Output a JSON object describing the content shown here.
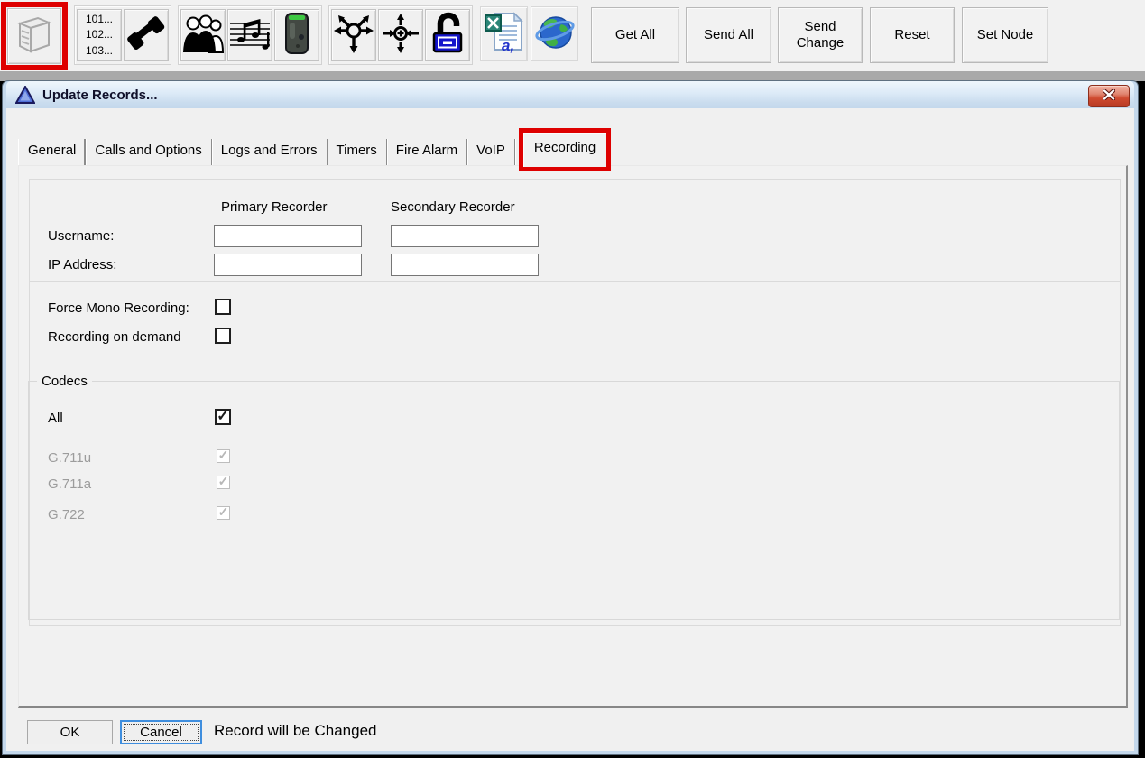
{
  "annotation": {
    "color": "#de0000",
    "targets": [
      "server-toolbar-button",
      "recording-tab"
    ]
  },
  "toolbar": {
    "icons": [
      "server-icon",
      "extension-list-icon",
      "phone-icon",
      "contacts-icon",
      "music-icon",
      "recorder-icon",
      "broadcast-arrows-icon",
      "multicast-target-icon",
      "lock-icon",
      "excel-export-icon",
      "globe-icon"
    ],
    "extension_list_lines": [
      "101...",
      "102...",
      "103..."
    ],
    "buttons": {
      "get_all": "Get All",
      "send_all": "Send All",
      "send_change": "Send Change",
      "reset": "Reset",
      "set_node": "Set Node"
    }
  },
  "dialog": {
    "title": "Update Records...",
    "tabs": [
      {
        "label": "General",
        "active": false
      },
      {
        "label": "Calls and Options",
        "active": false
      },
      {
        "label": "Logs and Errors",
        "active": false
      },
      {
        "label": "Timers",
        "active": false
      },
      {
        "label": "Fire Alarm",
        "active": false
      },
      {
        "label": "VoIP",
        "active": false
      },
      {
        "label": "Recording",
        "active": true
      }
    ],
    "recording_tab": {
      "column_headers": {
        "primary": "Primary Recorder",
        "secondary": "Secondary Recorder"
      },
      "rows": [
        {
          "label": "Username:",
          "primary_value": "",
          "secondary_value": ""
        },
        {
          "label": "IP Address:",
          "primary_value": "",
          "secondary_value": ""
        }
      ],
      "options": [
        {
          "label": "Force Mono Recording:",
          "checked": false
        },
        {
          "label": "Recording on demand",
          "checked": false
        }
      ],
      "codecs": {
        "legend": "Codecs",
        "items": [
          {
            "label": "All",
            "checked": true,
            "disabled": false
          },
          {
            "label": "G.711u",
            "checked": true,
            "disabled": true
          },
          {
            "label": "G.711a",
            "checked": true,
            "disabled": true
          },
          {
            "label": "G.722",
            "checked": true,
            "disabled": true
          }
        ]
      }
    },
    "footer": {
      "ok": "OK",
      "cancel": "Cancel",
      "status": "Record will be Changed"
    }
  }
}
